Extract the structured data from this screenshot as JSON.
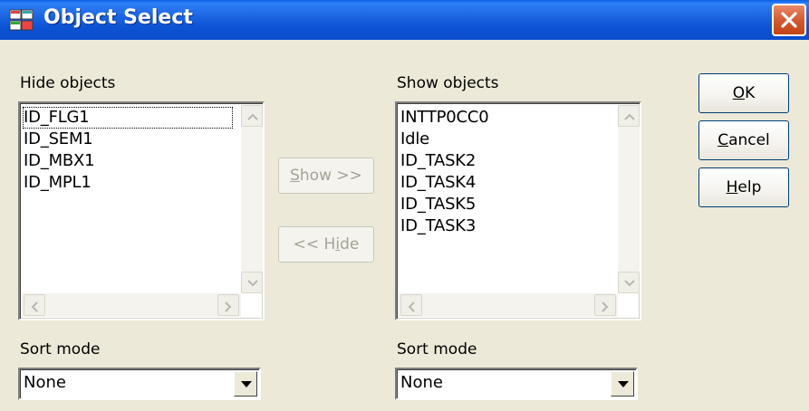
{
  "window": {
    "title": "Object Select",
    "close_icon": "close-icon",
    "app_icon": "object-select-app-icon"
  },
  "hide_panel": {
    "label": "Hide objects",
    "items": [
      "ID_FLG1",
      "ID_SEM1",
      "ID_MBX1",
      "ID_MPL1"
    ],
    "focused_index": 0,
    "sort_label": "Sort mode",
    "sort_value": "None"
  },
  "show_panel": {
    "label": "Show objects",
    "items": [
      "INTTP0CC0",
      "Idle",
      "ID_TASK2",
      "ID_TASK4",
      "ID_TASK5",
      "ID_TASK3"
    ],
    "sort_label": "Sort mode",
    "sort_value": "None"
  },
  "transfer": {
    "show_prefix": "",
    "show_mnemonic": "S",
    "show_rest": "how >>",
    "hide_prefix": "<< H",
    "hide_mnemonic": "i",
    "hide_rest": "de"
  },
  "buttons": {
    "ok_mnemonic": "O",
    "ok_rest": "K",
    "cancel_mnemonic": "C",
    "cancel_rest": "ancel",
    "help_mnemonic": "H",
    "help_rest": "elp"
  },
  "colors": {
    "titlebar": "#0a5fe6",
    "dialog_bg": "#ece9d8",
    "close_button": "#d35a30",
    "disabled_text": "#a5a295"
  }
}
